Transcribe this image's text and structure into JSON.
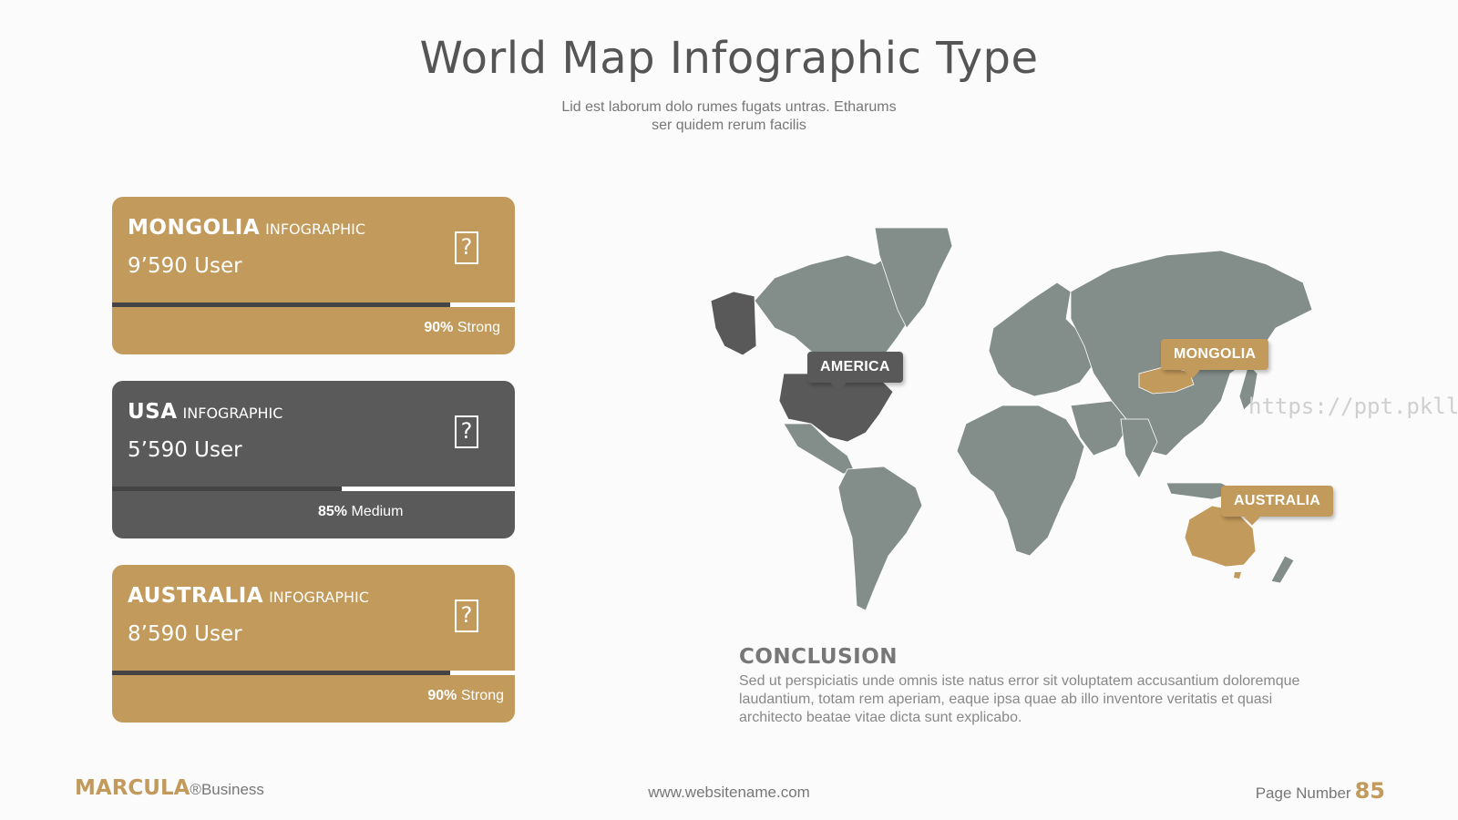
{
  "header": {
    "title": "World Map Infographic Type",
    "subtitle_line1": "Lid est laborum dolo rumes fugats untras. Etharums",
    "subtitle_line2": "ser quidem rerum facilis"
  },
  "cards": [
    {
      "country": "MONGOLIA",
      "kind": "INFOGRAPHIC",
      "users": "9’590 User",
      "percent": "90%",
      "strength": "Strong",
      "progress": 0.84,
      "color": "#c29a5b"
    },
    {
      "country": "USA",
      "kind": "INFOGRAPHIC",
      "users": "5’590 User",
      "percent": "85%",
      "strength": "Medium",
      "progress": 0.57,
      "color": "#5a5a5a"
    },
    {
      "country": "AUSTRALIA",
      "kind": "INFOGRAPHIC",
      "users": "8’590 User",
      "percent": "90%",
      "strength": "Strong",
      "progress": 0.84,
      "color": "#c29a5b"
    }
  ],
  "map": {
    "labels": {
      "america": "AMERICA",
      "mongolia": "MONGOLIA",
      "australia": "AUSTRALIA"
    },
    "colors": {
      "land": "#838d8a",
      "highlight_dark": "#595959",
      "highlight_gold": "#c29a5b"
    }
  },
  "watermark": "https://ppt.pkll.de",
  "conclusion": {
    "title": "CONCLUSION",
    "text": "Sed ut perspiciatis unde omnis iste natus error sit voluptatem accusantium doloremque laudantium, totam rem aperiam, eaque ipsa quae ab illo inventore veritatis et quasi architecto beatae vitae dicta sunt explicabo."
  },
  "footer": {
    "brand": "MARCULA",
    "brand_suffix": "®Business",
    "website": "www.websitename.com",
    "page_label": "Page Number",
    "page_number": "85"
  }
}
